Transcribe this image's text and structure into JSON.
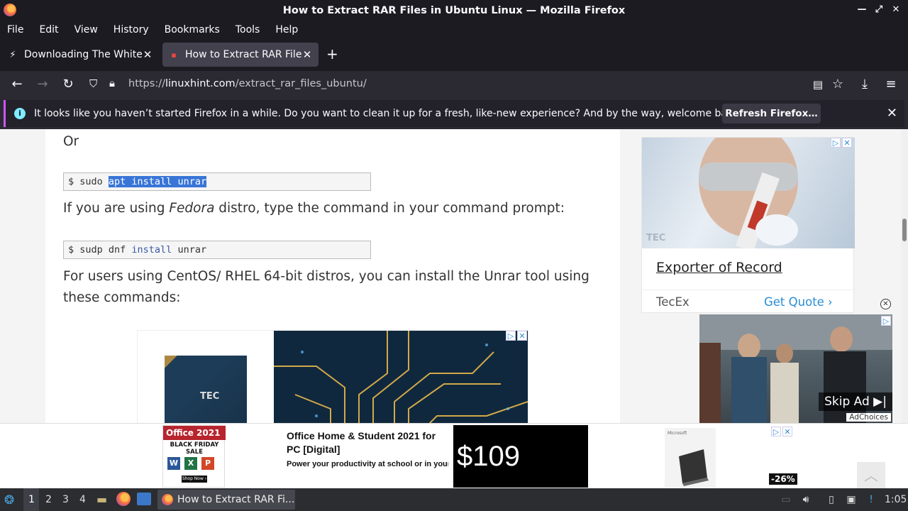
{
  "window": {
    "title": "How to Extract RAR Files in Ubuntu Linux — Mozilla Firefox"
  },
  "menu": [
    "File",
    "Edit",
    "View",
    "History",
    "Bookmarks",
    "Tools",
    "Help"
  ],
  "tabs": [
    {
      "title": "Downloading The White H",
      "active": false
    },
    {
      "title": "How to Extract RAR Files in Ubuntu Linux",
      "active": true
    }
  ],
  "url": {
    "prefix": "https://",
    "domain": "linuxhint.com",
    "path": "/extract_rar_files_ubuntu/"
  },
  "notification": {
    "message": "It looks like you haven’t started Firefox in a while. Do you want to clean it up for a fresh, like-new experience? And by the way, welcome back!",
    "button": "Refresh Firefox…"
  },
  "article": {
    "or_text": "Or",
    "code1": {
      "prompt": "$ sudo ",
      "selected": "apt install unrar"
    },
    "fedora_pre": "If you are using ",
    "fedora_em": "Fedora",
    "fedora_post": " distro, type the command in your command prompt:",
    "code2": {
      "prompt": "$ sudp dnf ",
      "kw": "install",
      "rest": " unrar"
    },
    "centos_text": "For users using CentOS/ RHEL 64-bit distros, you can install the Unrar tool using these commands:"
  },
  "sidebar_ad": {
    "logo": "TEC",
    "headline": "Exporter of Record",
    "brand": "TecEx",
    "cta": "Get Quote"
  },
  "video_ad": {
    "skip": "Skip Ad",
    "adchoices": "AdChoices"
  },
  "inline_ad": {
    "logo": "TEC"
  },
  "bottom_ad": {
    "badge": "Office 2021",
    "sale": "BLACK FRIDAY SALE",
    "shop": "Shop Now ›",
    "title": "Office Home & Student 2021 for PC [Digital]",
    "desc": "Power your productivity at school or in your home office",
    "price": "$109",
    "brand": "Microsoft",
    "discount": "-26%"
  },
  "taskbar": {
    "workspaces": [
      "1",
      "2",
      "3",
      "4"
    ],
    "active_window": "How to Extract RAR Fi...",
    "clock": "1:05"
  },
  "colors": {
    "accent_link": "#2a8dd4",
    "selection": "#3875d7",
    "chrome_dark": "#1c1b22"
  }
}
